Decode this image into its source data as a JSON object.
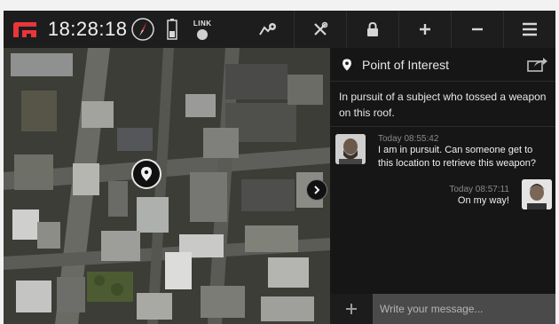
{
  "header": {
    "clock": "18:28:18",
    "link_label": "LINK",
    "icons": [
      "logo-icon",
      "compass-icon",
      "battery-icon",
      "link-status-icon",
      "route-icon",
      "tools-icon",
      "lock-icon",
      "zoom-in-icon",
      "zoom-out-icon",
      "menu-icon"
    ]
  },
  "poi": {
    "title": "Point of Interest",
    "description": "In pursuit of a subject who tossed a weapon on this roof."
  },
  "messages": [
    {
      "time": "Today 08:55:42",
      "text": "I am in pursuit. Can someone get to this location to retrieve this weapon?"
    },
    {
      "time": "Today 08:57:11",
      "text": "On my way!"
    }
  ],
  "compose": {
    "placeholder": "Write your message..."
  },
  "colors": {
    "accent": "#e8363a",
    "panel_bg": "#161616",
    "compose_bg": "#4a4a4a"
  }
}
